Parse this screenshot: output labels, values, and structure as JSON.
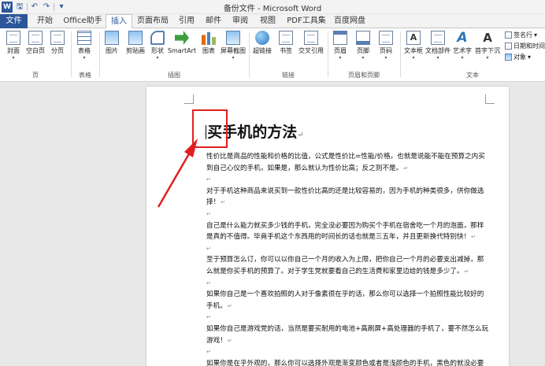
{
  "window": {
    "title": "备份文件 - Microsoft Word"
  },
  "qat": {
    "app_icon": "W",
    "save": "save-icon",
    "undo": "undo-icon",
    "redo": "redo-icon",
    "customize": "customize-icon"
  },
  "tabs": [
    "文件",
    "开始",
    "Office助手",
    "插入",
    "页面布局",
    "引用",
    "邮件",
    "审阅",
    "视图",
    "PDF工具集",
    "百度网盘"
  ],
  "active_tab": "插入",
  "ribbon": {
    "buttons": {
      "cover": "封面",
      "blank": "空白页",
      "pagebreak": "分页",
      "table": "表格",
      "picture": "图片",
      "clipart": "剪贴画",
      "shapes": "形状",
      "smartart": "SmartArt",
      "chart": "图表",
      "screenshot": "屏幕截图",
      "hyperlink": "超链接",
      "bookmark": "书签",
      "crossref": "交叉引用",
      "header": "页眉",
      "footer": "页脚",
      "pagenum": "页码",
      "textbox": "文本框",
      "docparts": "文档部件",
      "wordart": "艺术字",
      "dropcap": "首字下沉"
    },
    "small": {
      "signature": "签名行",
      "datetime": "日期和时间",
      "object": "对象"
    },
    "groups": {
      "page": "页",
      "table": "表格",
      "illustrations": "插图",
      "links": "链接",
      "headerfooter": "页眉和页脚",
      "text": "文本"
    }
  },
  "document": {
    "title": "买手机的方法",
    "paragraphs": [
      "性价比是商品的性能和价格的比值，公式是性价比=性能/价格，也就是说能不能在预算之内买到自己心仪的手机，如果是，那么就认为性价比高；反之则不是。",
      "对于手机这种商品来说买到一款性价比高的还是比较容易的，因为手机的种类很多，供你做选择！",
      "自己是什么能力就买多少钱的手机，完全没必要因为购买个手机在宿舍吃一个月的泡面，那样是真的不值得。毕竟手机这个东西用的时间长的话也就是三五年，并且更新换代特别快！",
      "至于预算怎么订，你可以以你自己一个月的收入为上限，把你自己一个月的必要支出减掉，那么就是你买手机的预算了。对于学生党就要看自己的生活费和家里边给的钱是多少了。",
      "如果你自己是一个喜欢拍照的人对于像素很在乎的话，那么你可以选择一个拍照性能比较好的手机。",
      "如果你自己是游戏党的话，当然是要买耐用的电池+高刷屏+高处理器的手机了，要不然怎么玩游戏！",
      "如果你是在乎外观的，那么你可以选择外观是渐变颜色或者是浅颜色的手机，黑色的就没必要去选了，还有就是手机屏幕，是全屏还是带有刘海屏的。"
    ]
  },
  "colors": {
    "accent": "#2b579a",
    "highlight": "#e02020"
  }
}
